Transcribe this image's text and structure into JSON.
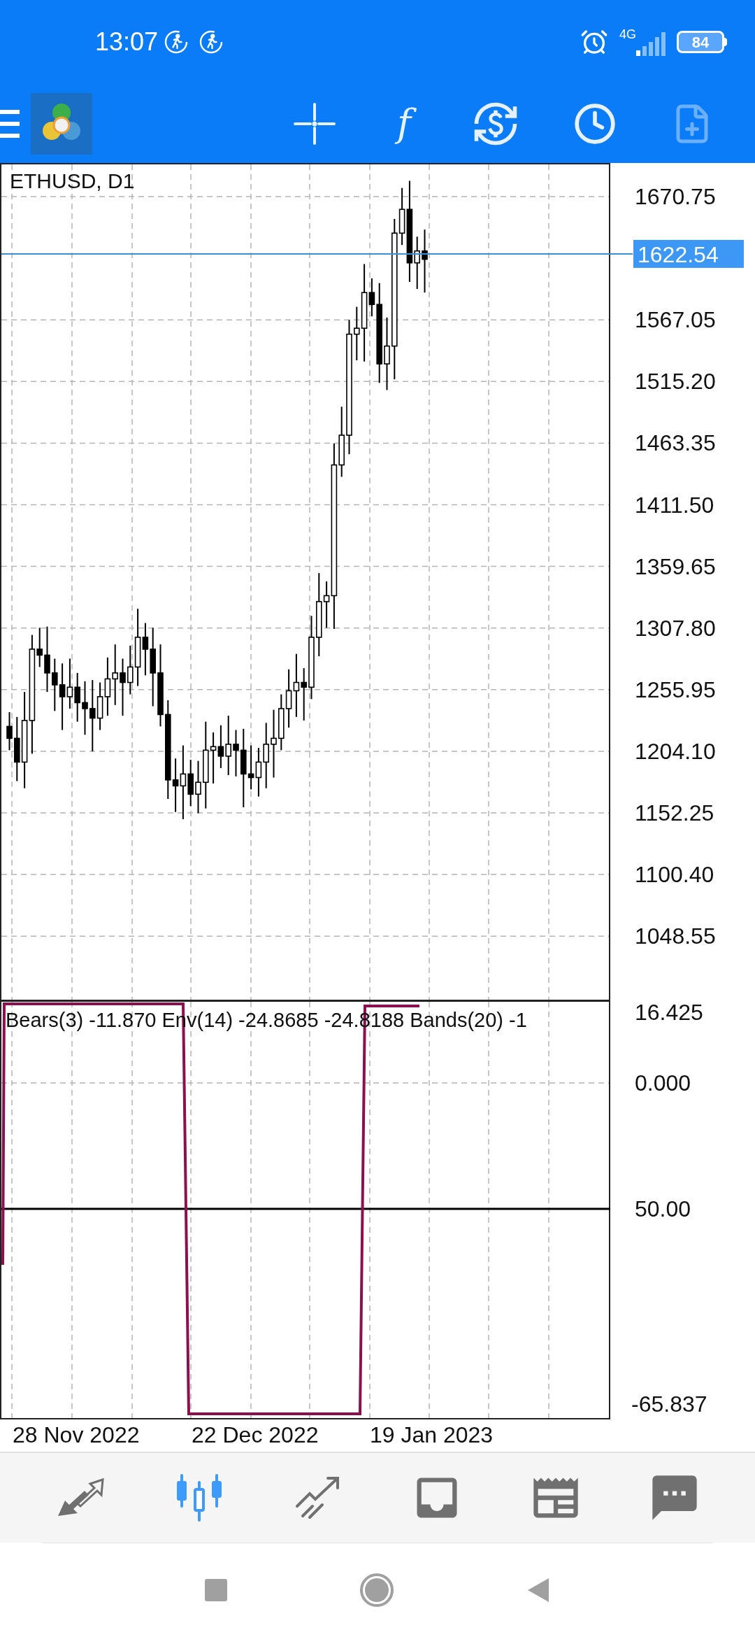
{
  "status_bar": {
    "time": "13:07",
    "network": "4G",
    "battery": "84"
  },
  "toolbar": {
    "function_glyph": "f"
  },
  "chart": {
    "symbol": "ETHUSD, D1",
    "current_price": "1622.54",
    "price_ticks": [
      "1670.75",
      "1567.05",
      "1515.20",
      "1463.35",
      "1411.50",
      "1359.65",
      "1307.80",
      "1255.95",
      "1204.10",
      "1152.25",
      "1100.40",
      "1048.55"
    ],
    "indicator_label": "Bears(3) -11.870 Env(14) -24.8685 -24.8188 Bands(20) -1",
    "indicator_ticks": [
      "16.425",
      "0.000",
      "50.00",
      "-65.837"
    ],
    "dates": [
      "28 Nov 2022",
      "22 Dec 2022",
      "19 Jan 2023"
    ]
  },
  "bottom_nav": [
    {
      "kind": "trade",
      "selected": false
    },
    {
      "kind": "chart",
      "selected": true
    },
    {
      "kind": "history",
      "selected": false
    },
    {
      "kind": "inbox",
      "selected": false
    },
    {
      "kind": "news",
      "selected": false
    },
    {
      "kind": "chat",
      "selected": false
    }
  ]
}
